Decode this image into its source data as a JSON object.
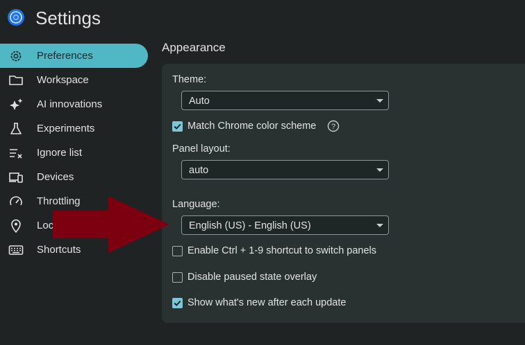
{
  "app": {
    "title": "Settings",
    "logo_icon": "chrome-devtools-icon"
  },
  "sidebar": {
    "items": [
      {
        "label": "Preferences",
        "icon": "gear-icon",
        "active": true
      },
      {
        "label": "Workspace",
        "icon": "folder-icon"
      },
      {
        "label": "AI innovations",
        "icon": "sparkle-icon"
      },
      {
        "label": "Experiments",
        "icon": "flask-icon"
      },
      {
        "label": "Ignore list",
        "icon": "ignore-list-icon"
      },
      {
        "label": "Devices",
        "icon": "devices-icon"
      },
      {
        "label": "Throttling",
        "icon": "speedometer-icon"
      },
      {
        "label": "Locations",
        "icon": "location-pin-icon"
      },
      {
        "label": "Shortcuts",
        "icon": "keyboard-icon"
      }
    ]
  },
  "appearance": {
    "section_title": "Appearance",
    "theme": {
      "label": "Theme:",
      "value": "Auto"
    },
    "match_chrome": {
      "label": "Match Chrome color scheme",
      "checked": true
    },
    "panel_layout": {
      "label": "Panel layout:",
      "value": "auto"
    },
    "language": {
      "label": "Language:",
      "value": "English (US) - English (US)"
    },
    "ctrl_shortcut": {
      "label": "Enable Ctrl + 1-9 shortcut to switch panels",
      "checked": false
    },
    "paused_overlay": {
      "label": "Disable paused state overlay",
      "checked": false
    },
    "whats_new": {
      "label": "Show what's new after each update",
      "checked": true
    }
  },
  "colors": {
    "accent": "#4fb8c4",
    "background": "#1f2323",
    "card": "#293131",
    "annotation_arrow": "#7d0011"
  }
}
